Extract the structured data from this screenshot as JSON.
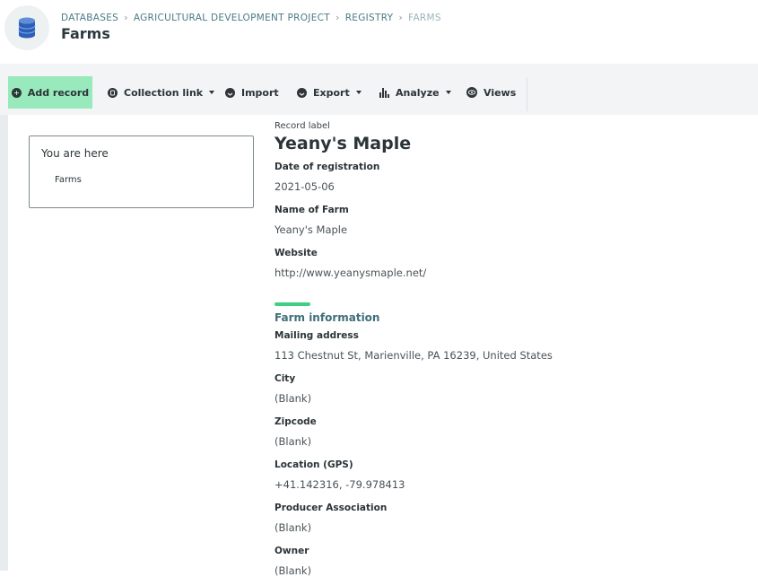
{
  "breadcrumb": [
    "DATABASES",
    "AGRICULTURAL DEVELOPMENT PROJECT",
    "REGISTRY",
    "FARMS"
  ],
  "page_title": "Farms",
  "toolbar": {
    "add_record": "Add record",
    "collection_link": "Collection link",
    "import": "Import",
    "export": "Export",
    "analyze": "Analyze",
    "views": "Views"
  },
  "you_are_here": {
    "title": "You are here",
    "item": "Farms"
  },
  "record": {
    "label_caption": "Record label",
    "title": "Yeany's Maple",
    "fields_top": [
      {
        "label": "Date of registration",
        "value": "2021-05-06"
      },
      {
        "label": "Name of Farm",
        "value": "Yeany's Maple"
      },
      {
        "label": "Website",
        "value": "http://www.yeanysmaple.net/"
      }
    ],
    "section_title": "Farm information",
    "fields_section": [
      {
        "label": "Mailing address",
        "value": "113 Chestnut St, Marienville, PA 16239, United States"
      },
      {
        "label": "City",
        "value": "(Blank)"
      },
      {
        "label": "Zipcode",
        "value": "(Blank)"
      },
      {
        "label": "Location (GPS)",
        "value": "+41.142316, -79.978413"
      },
      {
        "label": "Producer Association",
        "value": "(Blank)"
      },
      {
        "label": "Owner",
        "value": "(Blank)"
      }
    ]
  },
  "colors": {
    "primary_button": "#98e9bb",
    "accent_bar": "#3fcf82",
    "breadcrumb_link": "#4a7b86",
    "section_title": "#3f6e7a"
  }
}
